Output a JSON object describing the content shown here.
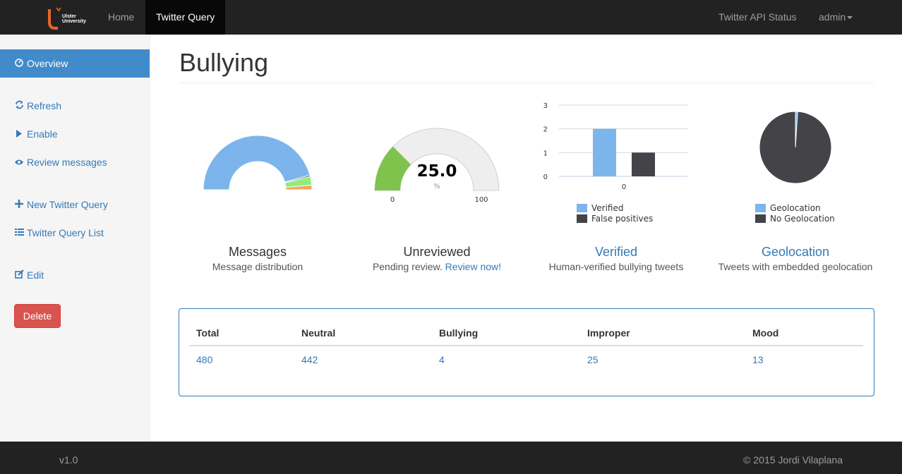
{
  "navbar": {
    "brand_line1": "Ulster",
    "brand_line2": "University",
    "home": "Home",
    "twitter_query": "Twitter Query",
    "api_status": "Twitter API Status",
    "user": "admin"
  },
  "sidebar": {
    "overview": "Overview",
    "refresh": "Refresh",
    "enable": "Enable",
    "review": "Review messages",
    "new_query": "New Twitter Query",
    "query_list": "Twitter Query List",
    "edit": "Edit",
    "delete": "Delete"
  },
  "page": {
    "title": "Bullying"
  },
  "widgets": {
    "messages": {
      "title": "Messages",
      "subtitle": "Message distribution"
    },
    "unreviewed": {
      "title": "Unreviewed",
      "subtitle": "Pending review.",
      "link": "Review now!",
      "value": "25.0",
      "unit": "%",
      "min": "0",
      "max": "100"
    },
    "verified": {
      "title": "Verified",
      "subtitle": "Human-verified bullying tweets"
    },
    "geolocation": {
      "title": "Geolocation",
      "subtitle": "Tweets with embedded geolocation"
    }
  },
  "chart_data": [
    {
      "type": "pie",
      "style": "semi-donut",
      "categories": [
        "Neutral",
        "Bullying",
        "Improper",
        "Mood"
      ],
      "values": [
        442,
        4,
        25,
        13
      ],
      "colors": [
        "#7cb5ec",
        "#434348",
        "#90ed7d",
        "#f7a35c"
      ]
    },
    {
      "type": "gauge",
      "value": 25.0,
      "min": 0,
      "max": 100,
      "colors": [
        "#7ec34b",
        "#eeeeee"
      ]
    },
    {
      "type": "bar",
      "categories": [
        "0"
      ],
      "series": [
        {
          "name": "Verified",
          "values": [
            2
          ],
          "color": "#7cb5ec"
        },
        {
          "name": "False positives",
          "values": [
            1
          ],
          "color": "#434348"
        }
      ],
      "yticks": [
        "0",
        "1",
        "2",
        "3"
      ],
      "ylim": [
        0,
        3
      ],
      "legend": "bottom"
    },
    {
      "type": "pie",
      "categories": [
        "Geolocation",
        "No Geolocation"
      ],
      "values": [
        1,
        99
      ],
      "colors": [
        "#7cb5ec",
        "#434348"
      ],
      "legend": "bottom"
    }
  ],
  "stats": {
    "headers": [
      "Total",
      "Neutral",
      "Bullying",
      "Improper",
      "Mood"
    ],
    "values": [
      "480",
      "442",
      "4",
      "25",
      "13"
    ]
  },
  "footer": {
    "version": "v1.0",
    "copyright": "© 2015 Jordi Vilaplana"
  }
}
